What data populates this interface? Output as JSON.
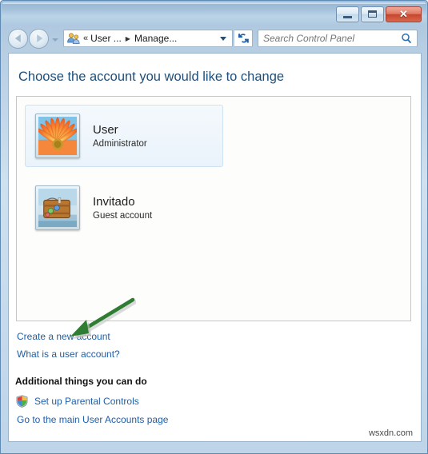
{
  "window": {
    "titlebar": {
      "minimize_label": "Minimize",
      "maximize_label": "Maximize",
      "close_label": "✕"
    }
  },
  "navigation": {
    "back_label": "Back",
    "forward_label": "Forward",
    "recent_pages_label": "Recent pages",
    "address_icon": "user-accounts-icon",
    "breadcrumb_overflow": "«",
    "breadcrumbs": [
      {
        "label": "User ...",
        "separator": "▶"
      },
      {
        "label": "Manage...",
        "separator": ""
      }
    ],
    "address_dropdown_label": "Previous locations",
    "refresh_label": "Refresh"
  },
  "search": {
    "placeholder": "Search Control Panel",
    "value": "",
    "icon": "search-icon"
  },
  "main": {
    "page_title": "Choose the account you would like to change",
    "accounts": [
      {
        "name": "User",
        "role": "Administrator",
        "avatar": "orange-flower-avatar",
        "selected": true
      },
      {
        "name": "Invitado",
        "role": "Guest account",
        "avatar": "suitcase-avatar",
        "selected": false
      }
    ],
    "links": [
      {
        "label": "Create a new account"
      },
      {
        "label": "What is a user account?"
      }
    ],
    "additional_heading": "Additional things you can do",
    "additional_links": [
      {
        "label": "Set up Parental Controls",
        "icon": "uac-shield-icon"
      },
      {
        "label": "Go to the main User Accounts page",
        "icon": ""
      }
    ]
  },
  "annotation": {
    "arrow_color": "#2f7d32",
    "arrow_target": "Create a new account"
  },
  "watermark": {
    "text": "wsxdn.com"
  },
  "colors": {
    "accent_link": "#1f5fa9",
    "title_text": "#1f4e79",
    "frame": "#5e8ab4",
    "close_button": "#c7452c"
  }
}
